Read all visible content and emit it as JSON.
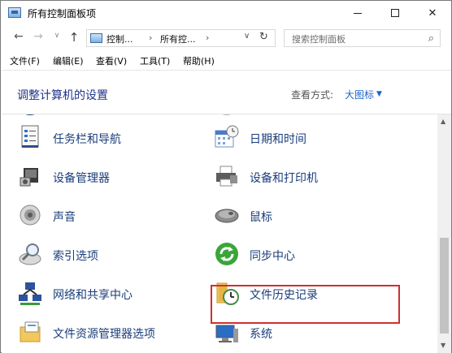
{
  "window": {
    "title": "所有控制面板项",
    "controls": {
      "minimize": "",
      "maximize": "",
      "close": "✕"
    }
  },
  "nav": {
    "back": "←",
    "forward": "→",
    "history": "∨",
    "up": "↑",
    "breadcrumbs": [
      "控制...",
      "›",
      "所有控...",
      "›"
    ],
    "dropdown": "∨",
    "refresh": "↻",
    "search_placeholder": "搜索控制面板"
  },
  "menu": [
    "文件(F)",
    "编辑(E)",
    "查看(V)",
    "工具(T)",
    "帮助(H)"
  ],
  "content": {
    "heading": "调整计算机的设置",
    "view_by_label": "查看方式:",
    "view_by_value": "大图标",
    "view_by_arrow": "▼"
  },
  "items_left": [
    {
      "label": "任务栏和导航",
      "icon": "taskbar-icon"
    },
    {
      "label": "设备管理器",
      "icon": "device-manager-icon"
    },
    {
      "label": "声音",
      "icon": "speaker-icon"
    },
    {
      "label": "索引选项",
      "icon": "indexing-icon"
    },
    {
      "label": "网络和共享中心",
      "icon": "network-icon"
    },
    {
      "label": "文件资源管理器选项",
      "icon": "folder-options-icon"
    }
  ],
  "items_right": [
    {
      "label": "日期和时间",
      "icon": "calendar-clock-icon"
    },
    {
      "label": "设备和打印机",
      "icon": "printer-icon"
    },
    {
      "label": "鼠标",
      "icon": "mouse-icon"
    },
    {
      "label": "同步中心",
      "icon": "sync-icon"
    },
    {
      "label": "文件历史记录",
      "icon": "file-history-icon"
    },
    {
      "label": "系统",
      "icon": "system-icon"
    }
  ],
  "scrollbar": {
    "up": "▲",
    "down": "▼"
  },
  "colors": {
    "link_blue": "#1a3d7a",
    "heading_blue": "#1e3287",
    "accent_blue": "#1e64c8",
    "highlight_red": "#d12f2f"
  }
}
